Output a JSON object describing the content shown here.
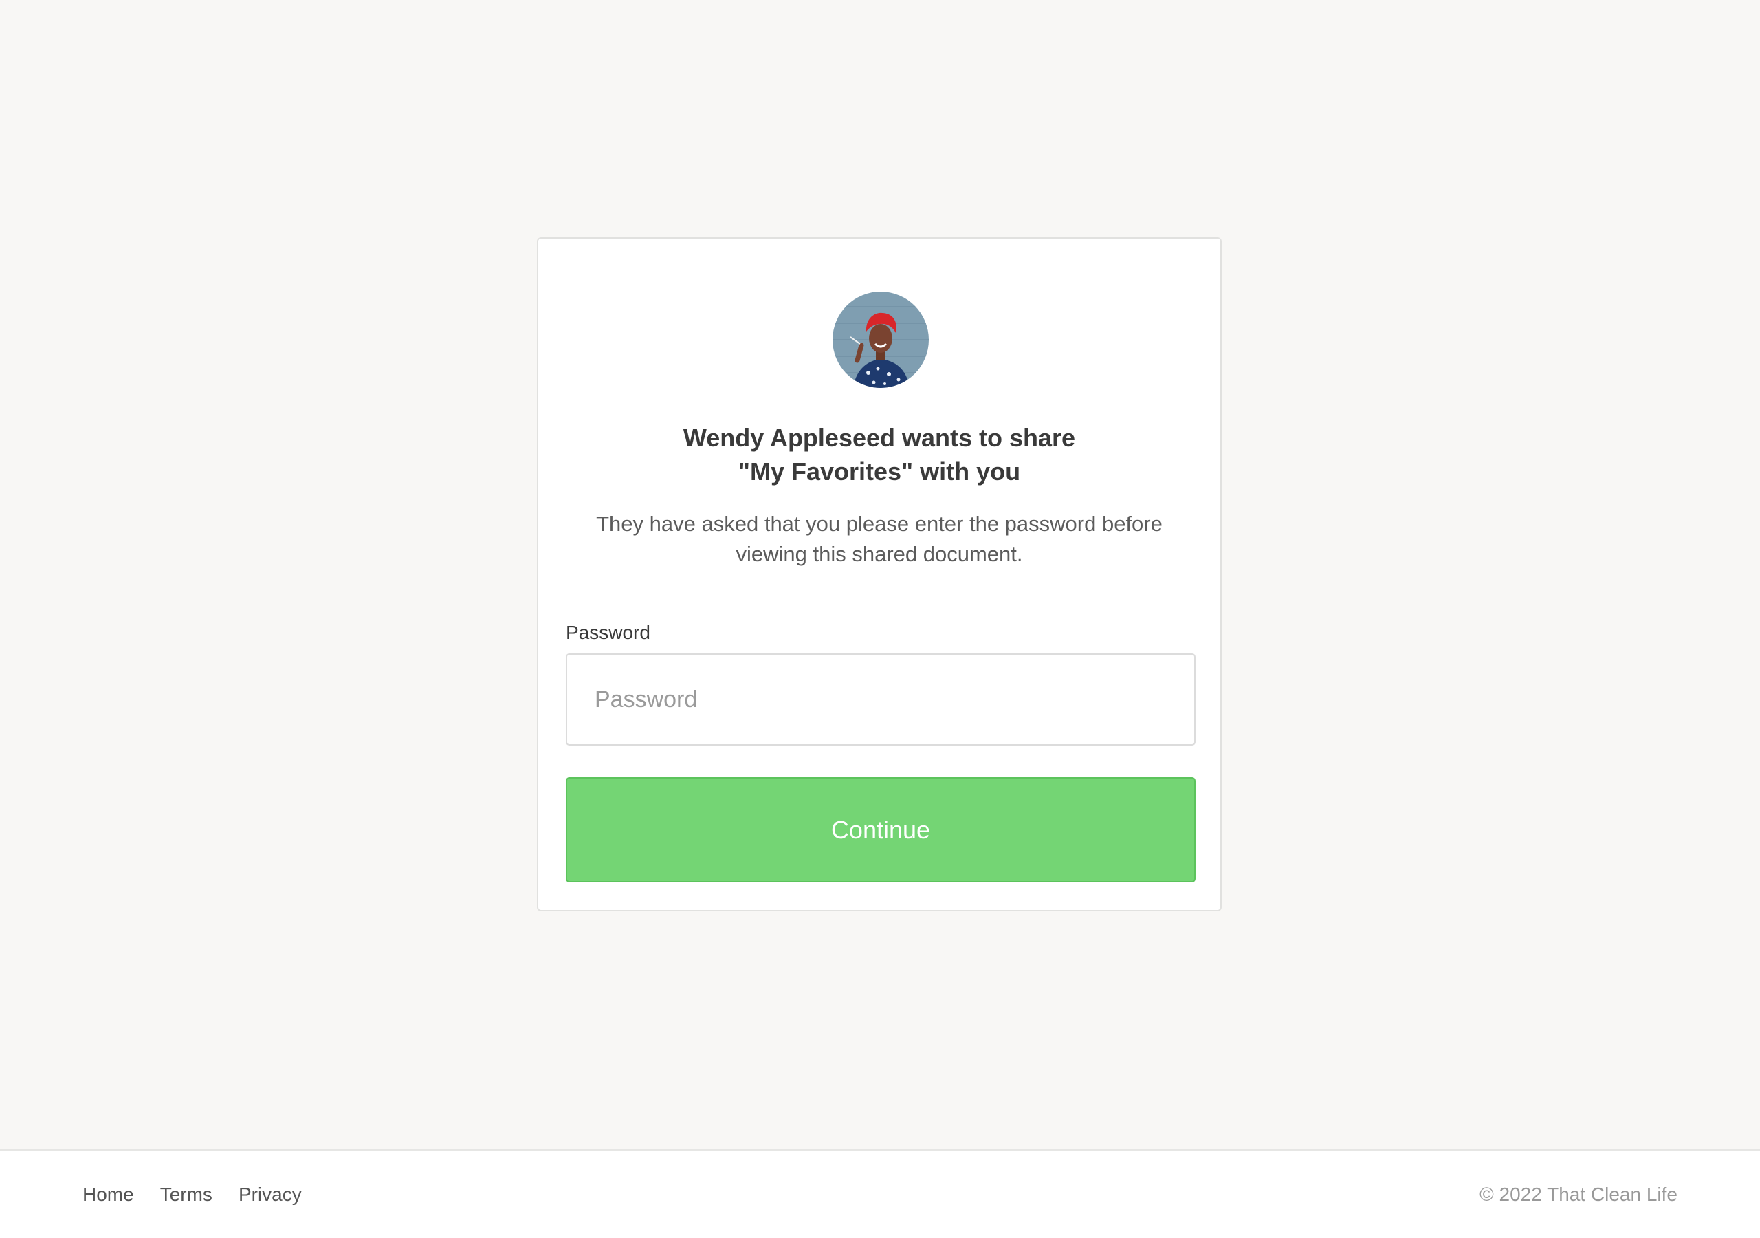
{
  "share_dialog": {
    "avatar": "person-photo",
    "title_line1": "Wendy Appleseed wants to share",
    "title_line2": "\"My Favorites\" with you",
    "subtitle_line1": "They have asked that you please enter the password before",
    "subtitle_line2": "viewing this shared document.",
    "password_label": "Password",
    "password_placeholder": "Password",
    "password_value": "",
    "continue_label": "Continue",
    "accent_color": "#74d574"
  },
  "footer": {
    "links": [
      {
        "label": "Home"
      },
      {
        "label": "Terms"
      },
      {
        "label": "Privacy"
      }
    ],
    "copyright": "© 2022 That Clean Life"
  }
}
